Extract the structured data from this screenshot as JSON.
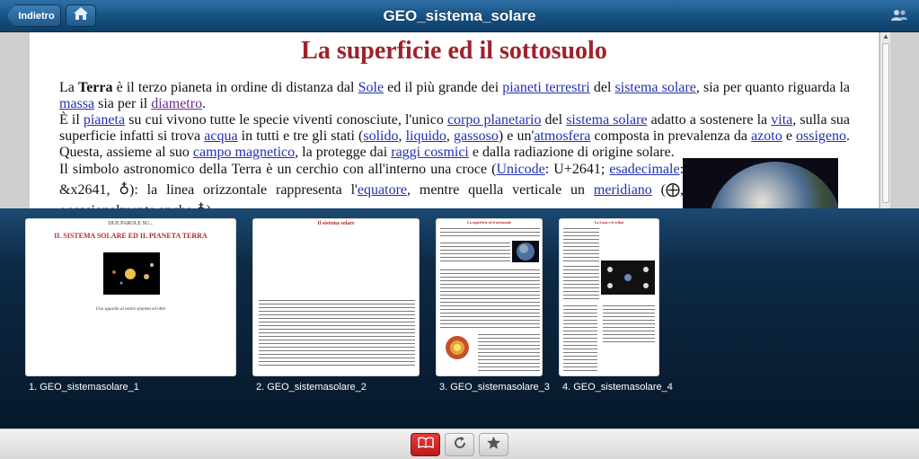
{
  "header": {
    "back_label": "Indietro",
    "title": "GEO_sistema_solare",
    "home_icon": "home-icon",
    "users_icon": "users-icon"
  },
  "document": {
    "heading": "La superficie ed il sottosuolo",
    "p1": {
      "t1": "La ",
      "b1": "Terra",
      "t2": " è il terzo pianeta in ordine di distanza dal ",
      "l_sole": "Sole",
      "t3": " ed il più grande dei ",
      "l_pianeti": "pianeti terrestri",
      "t4": " del ",
      "l_sistema": "sistema solare",
      "t5": ", sia per quanto riguarda la ",
      "l_massa": "massa",
      "t6": " sia per il ",
      "l_diametro": "diametro",
      "t7": "."
    },
    "p2": {
      "t1": "È il ",
      "l_pianeta": "pianeta",
      "t2": " su cui vivono tutte le specie viventi conosciute, l'unico ",
      "l_corpo": "corpo planetario",
      "t3": " del ",
      "l_sistema": "sistema solare",
      "t4": " adatto a sostenere la ",
      "l_vita": "vita",
      "t5": ", sulla sua superficie infatti si trova ",
      "l_acqua": "acqua",
      "t6": " in tutti e tre gli stati (",
      "l_solido": "solido",
      "t7": ", ",
      "l_liquido": "liquido",
      "t8": ", ",
      "l_gassoso": "gassoso",
      "t9": ") e un'",
      "l_atmosfera": "atmosfera",
      "t10": " composta in prevalenza da ",
      "l_azoto": "azoto",
      "t11": " e ",
      "l_ossigeno": "ossigeno",
      "t12": ". Questa, assieme al suo ",
      "l_campo": "campo magnetico",
      "t13": ", la protegge dai ",
      "l_raggi": "raggi cosmici",
      "t14": " e dalla radiazione di origine solare."
    },
    "p3": {
      "t1": "Il simbolo astronomico della Terra è un cerchio con all'interno una croce (",
      "l_unicode": "Unicode",
      "t2": ": U+2641; ",
      "l_esadecimale": "esadecimale",
      "t3": ": &x2641, ♁): la linea orizzontale rappresenta l'",
      "l_equatore": "equatore",
      "t4": ", mentre quella verticale un ",
      "l_meridiano": "meridiano",
      "t5": " (⨁, occasionalmente anche ♁)"
    }
  },
  "thumbnails": [
    {
      "label": "1. GEO_sistemasolare_1",
      "kicker": "DUE PAROLE SU...",
      "title": "IL SISTEMA SOLARE ED IL PIANETA TERRA",
      "subtitle": "Uno sguardo al nostro pianeta ed oltre"
    },
    {
      "label": "2. GEO_sistemasolare_2",
      "title": "Il sistema solare"
    },
    {
      "label": "3. GEO_sistemasolare_3",
      "title": "La superficie ed il sottosuolo"
    },
    {
      "label": "4. GEO_sistemasolare_4",
      "title": "La Luna e le eclissi"
    }
  ],
  "toolbar": {
    "bookmarks_icon": "open-book-icon",
    "refresh_icon": "refresh-icon",
    "favorite_icon": "star-icon"
  },
  "colors": {
    "header_blue": "#15507f",
    "heading_red": "#a0212a",
    "link_blue": "#2330b0",
    "active_red": "#d02a2a"
  }
}
